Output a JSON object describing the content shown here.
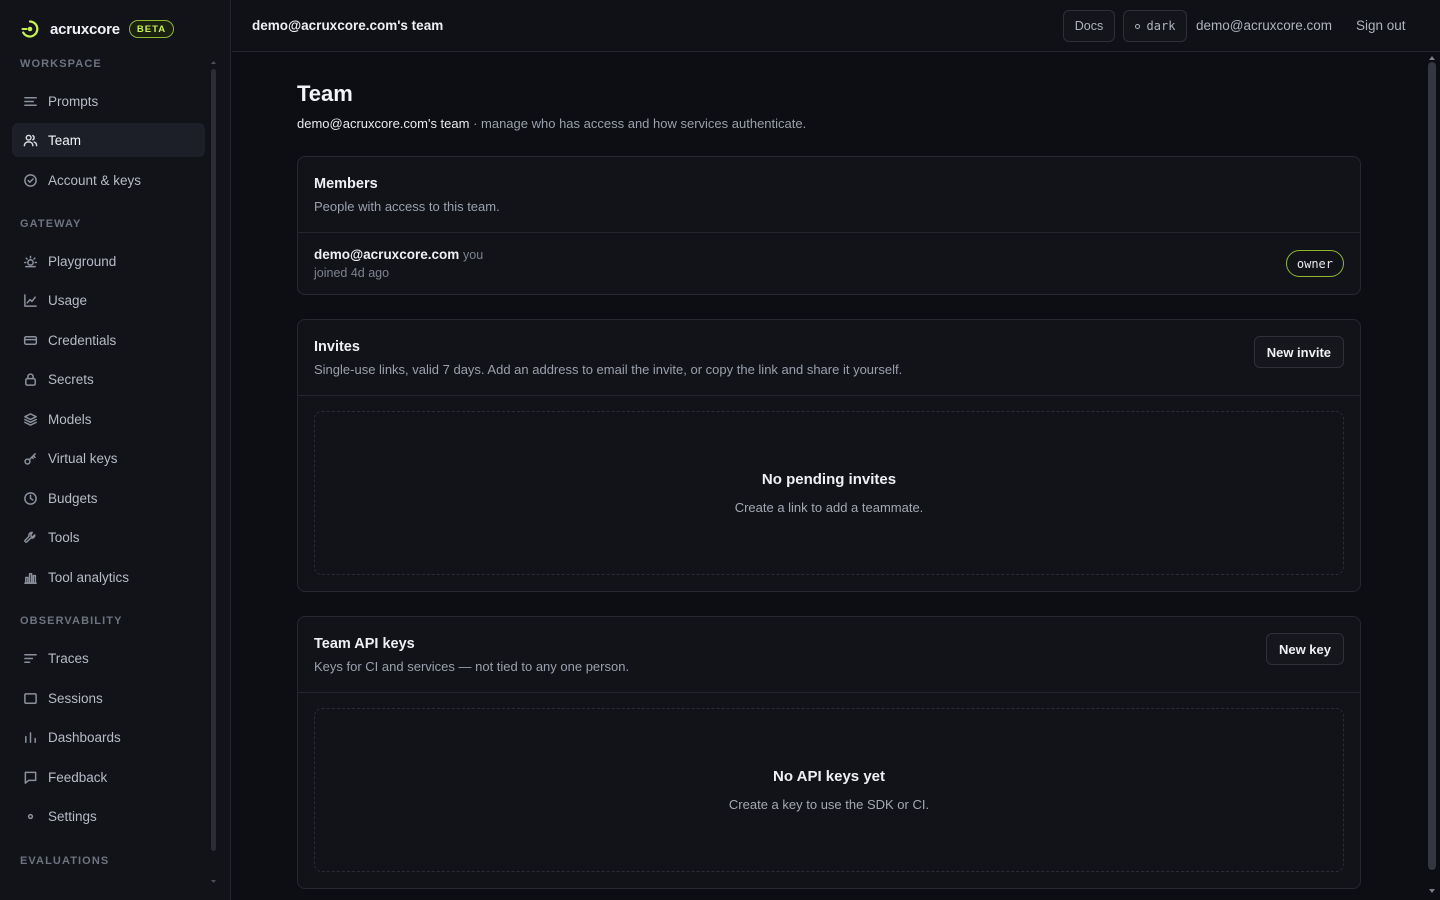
{
  "brand": {
    "name": "acruxcore",
    "badge": "BETA",
    "accent": "#c8f24a"
  },
  "sidebar": {
    "sections": [
      {
        "label": "WORKSPACE",
        "items": [
          {
            "label": "Prompts",
            "icon": "lines-icon"
          },
          {
            "label": "Team",
            "icon": "users-icon",
            "active": true
          },
          {
            "label": "Account & keys",
            "icon": "check-circle-icon"
          }
        ]
      },
      {
        "label": "GATEWAY",
        "items": [
          {
            "label": "Playground",
            "icon": "sun-icon"
          },
          {
            "label": "Usage",
            "icon": "line-chart-icon"
          },
          {
            "label": "Credentials",
            "icon": "card-icon"
          },
          {
            "label": "Secrets",
            "icon": "lock-icon"
          },
          {
            "label": "Models",
            "icon": "layers-icon"
          },
          {
            "label": "Virtual keys",
            "icon": "key-icon"
          },
          {
            "label": "Budgets",
            "icon": "clock-icon"
          },
          {
            "label": "Tools",
            "icon": "wrench-icon"
          },
          {
            "label": "Tool analytics",
            "icon": "bar-chart-icon"
          }
        ]
      },
      {
        "label": "OBSERVABILITY",
        "items": [
          {
            "label": "Traces",
            "icon": "traces-icon"
          },
          {
            "label": "Sessions",
            "icon": "window-icon"
          },
          {
            "label": "Dashboards",
            "icon": "columns-icon"
          },
          {
            "label": "Feedback",
            "icon": "message-icon"
          },
          {
            "label": "Settings",
            "icon": "dot-icon"
          }
        ]
      },
      {
        "label": "EVALUATIONS",
        "items": []
      }
    ]
  },
  "topbar": {
    "team_title": "demo@acruxcore.com's team",
    "docs_label": "Docs",
    "theme_label": "dark",
    "user_email": "demo@acruxcore.com",
    "signout_label": "Sign out"
  },
  "page": {
    "title": "Team",
    "subtitle_team": "demo@acruxcore.com's team",
    "subtitle_rest": " · manage who has access and how services authenticate."
  },
  "members": {
    "title": "Members",
    "description": "People with access to this team.",
    "rows": [
      {
        "email": "demo@acruxcore.com",
        "tag": "you",
        "joined": "joined 4d ago",
        "role": "owner"
      }
    ]
  },
  "invites": {
    "title": "Invites",
    "description": "Single-use links, valid 7 days. Add an address to email the invite, or copy the link and share it yourself.",
    "button": "New invite",
    "empty_title": "No pending invites",
    "empty_desc": "Create a link to add a teammate."
  },
  "api_keys": {
    "title": "Team API keys",
    "description": "Keys for CI and services — not tied to any one person.",
    "button": "New key",
    "empty_title": "No API keys yet",
    "empty_desc": "Create a key to use the SDK or CI."
  }
}
